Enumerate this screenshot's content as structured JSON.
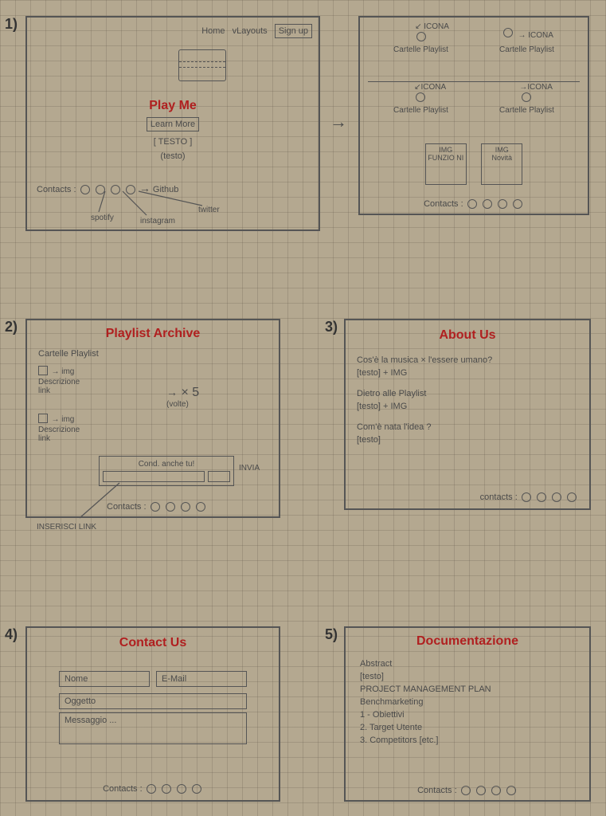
{
  "labels": {
    "n1": "1)",
    "n2": "2)",
    "n3": "3)",
    "n4": "4)",
    "n5": "5)"
  },
  "panel1L": {
    "nav_home": "Home",
    "nav_layouts": "vLayouts",
    "nav_signup": "Sign up",
    "title": "Play Me",
    "btn_learn": "Learn More",
    "testo_up": "[ TESTO ]",
    "testo_lo": "(testo)",
    "contacts_label": "Contacts :",
    "social_spotify": "spotify",
    "social_instagram": "instagram",
    "social_twitter": "twitter",
    "social_github": "Github"
  },
  "panel1R": {
    "icona": "ICONA",
    "card": "Cartelle Playlist",
    "img_label": "IMG",
    "card_funzioni": "FUNZIO NI",
    "card_novita": "Novità",
    "contacts_label": "Contacts :"
  },
  "panel2": {
    "title": "Playlist Archive",
    "card": "Cartelle Playlist",
    "img_hint": "→ img",
    "descrizione": "Descrizione",
    "link": "link",
    "x5": "× 5",
    "x5_note": "(volte)",
    "share_title": "Cond. anche tu!",
    "share_invia": "INVIA",
    "share_insert": "INSERISCI LINK",
    "contacts_label": "Contacts :"
  },
  "panel3": {
    "title": "About Us",
    "q1": "Cos'è la musica × l'essere umano?",
    "body1": "[testo] + IMG",
    "q2": "Dietro alle Playlist",
    "body2": "[testo] + IMG",
    "q3": "Com'è nata l'idea ?",
    "body3": "[testo]",
    "contacts_label": "contacts :"
  },
  "panel4": {
    "title": "Contact Us",
    "nome": "Nome",
    "email": "E-Mail",
    "oggetto": "Oggetto",
    "messaggio": "Messaggio ...",
    "contacts_label": "Contacts :"
  },
  "panel5": {
    "title": "Documentazione",
    "l1": "Abstract",
    "l2": "[testo]",
    "l3": "PROJECT MANAGEMENT PLAN",
    "l4": "Benchmarketing",
    "l5": "1 - Obiettivi",
    "l6": "2. Target Utente",
    "l7": "3. Competitors   [etc.]",
    "contacts_label": "Contacts :"
  },
  "arrow_between": "→"
}
